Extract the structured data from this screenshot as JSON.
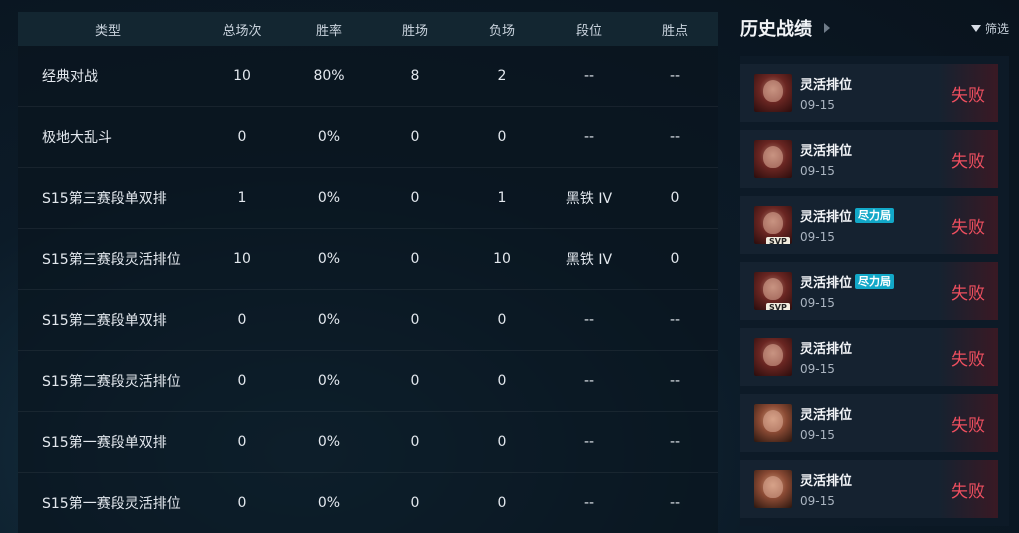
{
  "stats": {
    "headers": [
      "类型",
      "总场次",
      "胜率",
      "胜场",
      "负场",
      "段位",
      "胜点"
    ],
    "rows": [
      {
        "type": "经典对战",
        "total": "10",
        "winrate": "80%",
        "wins": "8",
        "losses": "2",
        "rank": "--",
        "lp": "--"
      },
      {
        "type": "极地大乱斗",
        "total": "0",
        "winrate": "0%",
        "wins": "0",
        "losses": "0",
        "rank": "--",
        "lp": "--"
      },
      {
        "type": "S15第三赛段单双排",
        "total": "1",
        "winrate": "0%",
        "wins": "0",
        "losses": "1",
        "rank": "黑铁 IV",
        "lp": "0"
      },
      {
        "type": "S15第三赛段灵活排位",
        "total": "10",
        "winrate": "0%",
        "wins": "0",
        "losses": "10",
        "rank": "黑铁 IV",
        "lp": "0"
      },
      {
        "type": "S15第二赛段单双排",
        "total": "0",
        "winrate": "0%",
        "wins": "0",
        "losses": "0",
        "rank": "--",
        "lp": "--"
      },
      {
        "type": "S15第二赛段灵活排位",
        "total": "0",
        "winrate": "0%",
        "wins": "0",
        "losses": "0",
        "rank": "--",
        "lp": "--"
      },
      {
        "type": "S15第一赛段单双排",
        "total": "0",
        "winrate": "0%",
        "wins": "0",
        "losses": "0",
        "rank": "--",
        "lp": "--"
      },
      {
        "type": "S15第一赛段灵活排位",
        "total": "0",
        "winrate": "0%",
        "wins": "0",
        "losses": "0",
        "rank": "--",
        "lp": "--"
      }
    ]
  },
  "history": {
    "title": "历史战绩",
    "filter_label": "筛选",
    "matches": [
      {
        "mode": "灵活排位",
        "date": "09-15",
        "result": "失败",
        "tag": "",
        "svp": "",
        "avatar_style": "a"
      },
      {
        "mode": "灵活排位",
        "date": "09-15",
        "result": "失败",
        "tag": "",
        "svp": "",
        "avatar_style": "a"
      },
      {
        "mode": "灵活排位",
        "date": "09-15",
        "result": "失败",
        "tag": "尽力局",
        "svp": "SVP",
        "avatar_style": "a"
      },
      {
        "mode": "灵活排位",
        "date": "09-15",
        "result": "失败",
        "tag": "尽力局",
        "svp": "SVP",
        "avatar_style": "a"
      },
      {
        "mode": "灵活排位",
        "date": "09-15",
        "result": "失败",
        "tag": "",
        "svp": "",
        "avatar_style": "a"
      },
      {
        "mode": "灵活排位",
        "date": "09-15",
        "result": "失败",
        "tag": "",
        "svp": "",
        "avatar_style": "b"
      },
      {
        "mode": "灵活排位",
        "date": "09-15",
        "result": "失败",
        "tag": "",
        "svp": "",
        "avatar_style": "b"
      }
    ]
  },
  "colors": {
    "loss_red": "#ef4f5f",
    "tag_cyan": "#12a8c8"
  }
}
